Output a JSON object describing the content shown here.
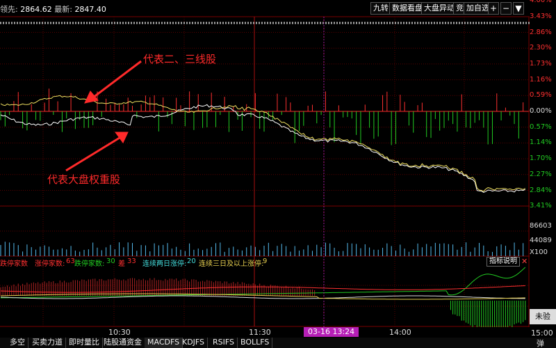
{
  "header": {
    "leading_label": "领先:",
    "leading_value": "2864.62",
    "latest_label": "最新:",
    "latest_value": "2847.40",
    "buttons": [
      "九转",
      "数据看盘",
      "大盘异动",
      "竞",
      "加自选"
    ],
    "icon_plus": "+",
    "icon_minus": "−",
    "icon_menu": "▼"
  },
  "price_axis": {
    "up": [
      "4.00%",
      "3.43%",
      "2.86%",
      "2.30%",
      "1.73%",
      "1.16%",
      "0.59%"
    ],
    "zero": "0.00%",
    "down": [
      "0.57%",
      "1.14%",
      "1.70%",
      "2.27%",
      "2.84%",
      "3.41%"
    ]
  },
  "volume_axis": {
    "top": "86603",
    "mid": "44089",
    "unit": "X100"
  },
  "annotations": {
    "second_third_tier": "代表二、三线股",
    "heavyweights": "代表大盘权重股"
  },
  "indicator": {
    "up_limit_label": "跌停家数",
    "limit_up_label": "涨停家数:",
    "limit_up_value": "63",
    "limit_down_label": "跌停家数:",
    "limit_down_value": "30",
    "diff_label": "差",
    "diff_value": "33",
    "two_day_label": "连续两日涨停:",
    "two_day_value": "20",
    "three_day_label": "连续三日及以上涨停:",
    "three_day_value": "9",
    "explain_button": "指标说明",
    "close_icon": "✕"
  },
  "time_axis": {
    "t1030": "10:30",
    "t1130": "11:30",
    "t1400": "14:00",
    "t1500": "15:00",
    "cursor": "03-16 13:24"
  },
  "side": {
    "box": "未验",
    "bottom": "弹"
  },
  "tabs": [
    "多空",
    "买卖力道",
    "即时量比",
    "陆股通资金",
    "MACDFS",
    "KDJFS",
    "RSIFS",
    "BOLLFS"
  ],
  "colors": {
    "up": "#ff3030",
    "down": "#22cc22",
    "grid": "#7a0000",
    "white_line": "#ffffff",
    "yellow_line": "#f0e060"
  }
}
